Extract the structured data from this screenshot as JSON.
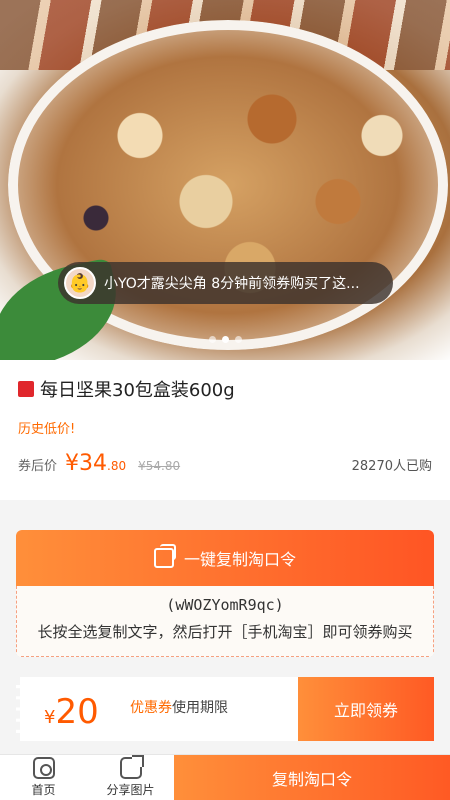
{
  "hero": {
    "toast_message": "小YO才露尖尖角 8分钟前领券购买了这...",
    "avatar_glyph": "👶",
    "carousel": {
      "count": 3,
      "active_index": 1
    }
  },
  "product": {
    "shop_icon_glyph": "🛍",
    "title": "每日坚果30包盒装600g",
    "tag": "历史低价!",
    "price_label": "券后价",
    "price_main": "¥34",
    "price_decimal": ".80",
    "original_price": "¥54.80",
    "sold": "28270人已购"
  },
  "copy_card": {
    "button_label": "一键复制淘口令",
    "code": "(wWOZYomR9qc)",
    "instructions": "长按全选复制文字，然后打开［手机淘宝］即可领券购买"
  },
  "coupon": {
    "currency": "¥",
    "amount": "20",
    "label_highlight": "优惠券",
    "label_rest": "使用期限",
    "claim_label": "立即领券"
  },
  "bottom_bar": {
    "home_label": "首页",
    "share_label": "分享图片",
    "copy_label": "复制淘口令"
  },
  "colors": {
    "accent": "#ff5a24",
    "accent_light": "#ff8f3a",
    "price": "#ff5a00"
  }
}
